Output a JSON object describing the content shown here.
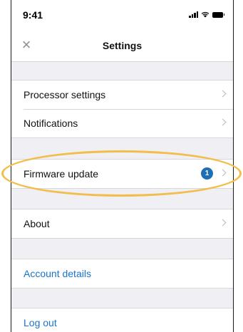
{
  "status_bar": {
    "time": "9:41"
  },
  "nav": {
    "title": "Settings",
    "close_icon": "close-icon"
  },
  "groups": [
    {
      "items": [
        {
          "label": "Processor settings"
        },
        {
          "label": "Notifications"
        }
      ]
    },
    {
      "items": [
        {
          "label": "Firmware update",
          "badge": "1"
        }
      ]
    },
    {
      "items": [
        {
          "label": "About"
        }
      ]
    },
    {
      "items": [
        {
          "label": "Account details"
        }
      ]
    },
    {
      "items": [
        {
          "label": "Log out"
        }
      ]
    }
  ],
  "colors": {
    "accent_link": "#1a73c9",
    "badge": "#1f6fb5",
    "highlight_ring": "#f2bd4a",
    "background": "#efeff4"
  }
}
